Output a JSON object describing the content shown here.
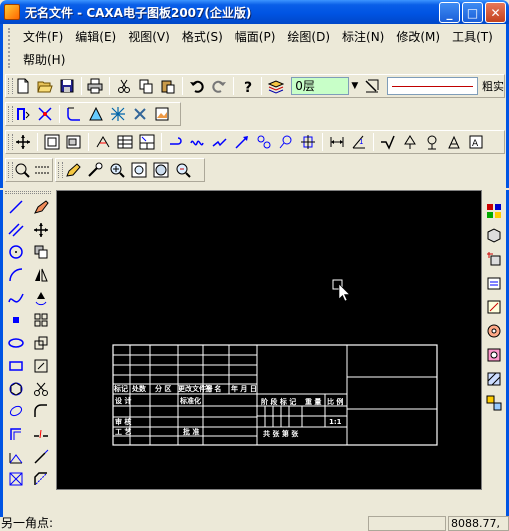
{
  "window": {
    "title": "无名文件 - CAXA电子图板2007(企业版)",
    "minimize_label": "_",
    "maximize_label": "□",
    "close_label": "✕"
  },
  "menu": {
    "items": [
      {
        "id": "file",
        "label": "文件(F)"
      },
      {
        "id": "edit",
        "label": "编辑(E)"
      },
      {
        "id": "view",
        "label": "视图(V)"
      },
      {
        "id": "format",
        "label": "格式(S)"
      },
      {
        "id": "sheet",
        "label": "幅面(P)"
      },
      {
        "id": "draw",
        "label": "绘图(D)"
      },
      {
        "id": "dimension",
        "label": "标注(N)"
      },
      {
        "id": "modify",
        "label": "修改(M)"
      },
      {
        "id": "tools",
        "label": "工具(T)"
      },
      {
        "id": "help",
        "label": "帮助(H)"
      }
    ]
  },
  "properties_toolbar": {
    "layer_value": "0层",
    "linetype_name": "粗实"
  },
  "title_block": {
    "row_mark": [
      "标记",
      "处数",
      "分 区",
      "更改文件号",
      "签 名",
      "年 月 日"
    ],
    "design": "设 计",
    "standardize": "标准化",
    "stage_mark": "阶 段 标 记",
    "weight": "重 量",
    "scale": "比 例",
    "scale_value": "1:1",
    "review": "审 核",
    "process": "工 艺",
    "approve": "批 准",
    "sheets": "共  张  第  张"
  },
  "status": {
    "prompt": "另一角点:",
    "coords": "8088.77,"
  },
  "colors": {
    "titlebar": "#0054E3",
    "canvas": "#000000",
    "layer_box": "#c8ffc8",
    "linetype": "#c00000"
  }
}
